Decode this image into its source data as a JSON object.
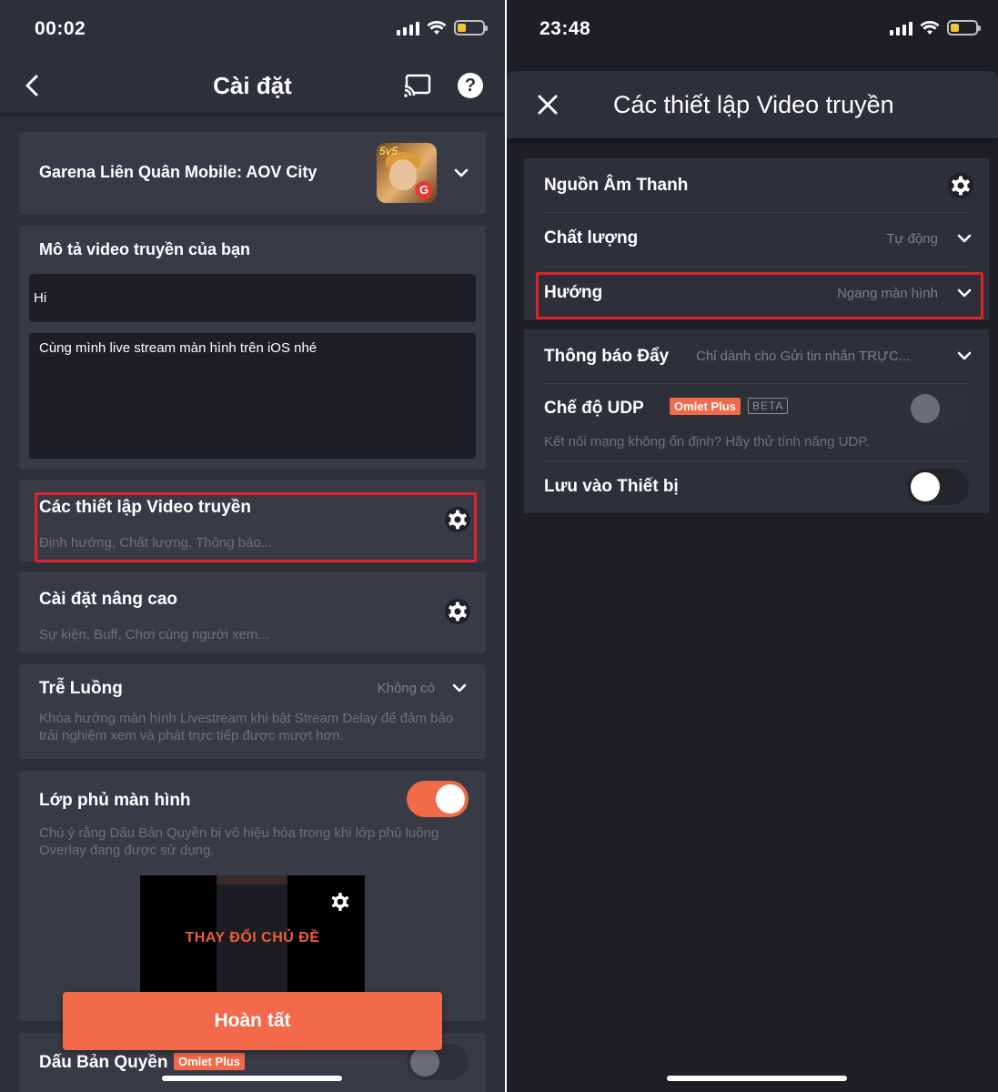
{
  "left": {
    "status": {
      "time": "00:02"
    },
    "header": {
      "title": "Cài đặt"
    },
    "game": {
      "name": "Garena Liên Quân Mobile: AOV City",
      "icon_badge": "5v5"
    },
    "description": {
      "label": "Mô tả video truyền của bạn",
      "title_value": "Hi",
      "body_value": "Cùng mình live stream màn hình trên iOS nhé"
    },
    "video_settings": {
      "title": "Các thiết lập Video truyền",
      "subtitle": "Định hướng, Chất lượng, Thông báo..."
    },
    "advanced": {
      "title": "Cài đặt nâng cao",
      "subtitle": "Sự kiện, Buff, Chơi cùng người xem..."
    },
    "stream_delay": {
      "title": "Trễ Luồng",
      "value": "Không có",
      "note": "Khóa hướng màn hình Livestream khi bật Stream Delay để đảm bảo trải nghiệm xem và phát trực tiếp được mượt hơn."
    },
    "overlay": {
      "title": "Lớp phủ màn hình",
      "enabled": true,
      "note": "Chú ý rằng Dấu Bản Quyền bị vô hiệu hóa trong khi lớp phủ luồng Overlay đang được sử dụng.",
      "preview_text": "THAY ĐỔI CHỦ ĐỀ"
    },
    "done_button": "Hoàn tất",
    "watermark": {
      "title": "Dấu Bản Quyền",
      "badge": "Omlet Plus",
      "enabled": false
    }
  },
  "right": {
    "status": {
      "time": "23:48"
    },
    "header": {
      "title": "Các thiết lập Video truyền"
    },
    "audio_source": {
      "label": "Nguồn Âm Thanh"
    },
    "quality": {
      "label": "Chất lượng",
      "value": "Tự động"
    },
    "orientation": {
      "label": "Hướng",
      "value": "Ngang màn hình"
    },
    "push_notify": {
      "label": "Thông báo Đẩy",
      "value": "Chỉ dành cho Gửi tin nhắn TRỰC..."
    },
    "udp": {
      "label": "Chế độ UDP",
      "badge_plus": "Omlet Plus",
      "badge_beta": "BETA",
      "note": "Kết nối mạng không ổn định? Hãy thử tính năng UDP.",
      "enabled": false
    },
    "save_device": {
      "label": "Lưu vào Thiết bị",
      "enabled": false
    }
  },
  "colors": {
    "accent": "#f26a49",
    "highlight_border": "#e0222c",
    "card_bg": "#383b45",
    "screen_bg": "#2d3038",
    "input_bg": "#1d1f25"
  },
  "icons": [
    "back-icon",
    "cast-icon",
    "help-icon",
    "chevron-down-icon",
    "gear-icon",
    "close-icon",
    "signal-icon",
    "wifi-icon",
    "battery-icon"
  ]
}
